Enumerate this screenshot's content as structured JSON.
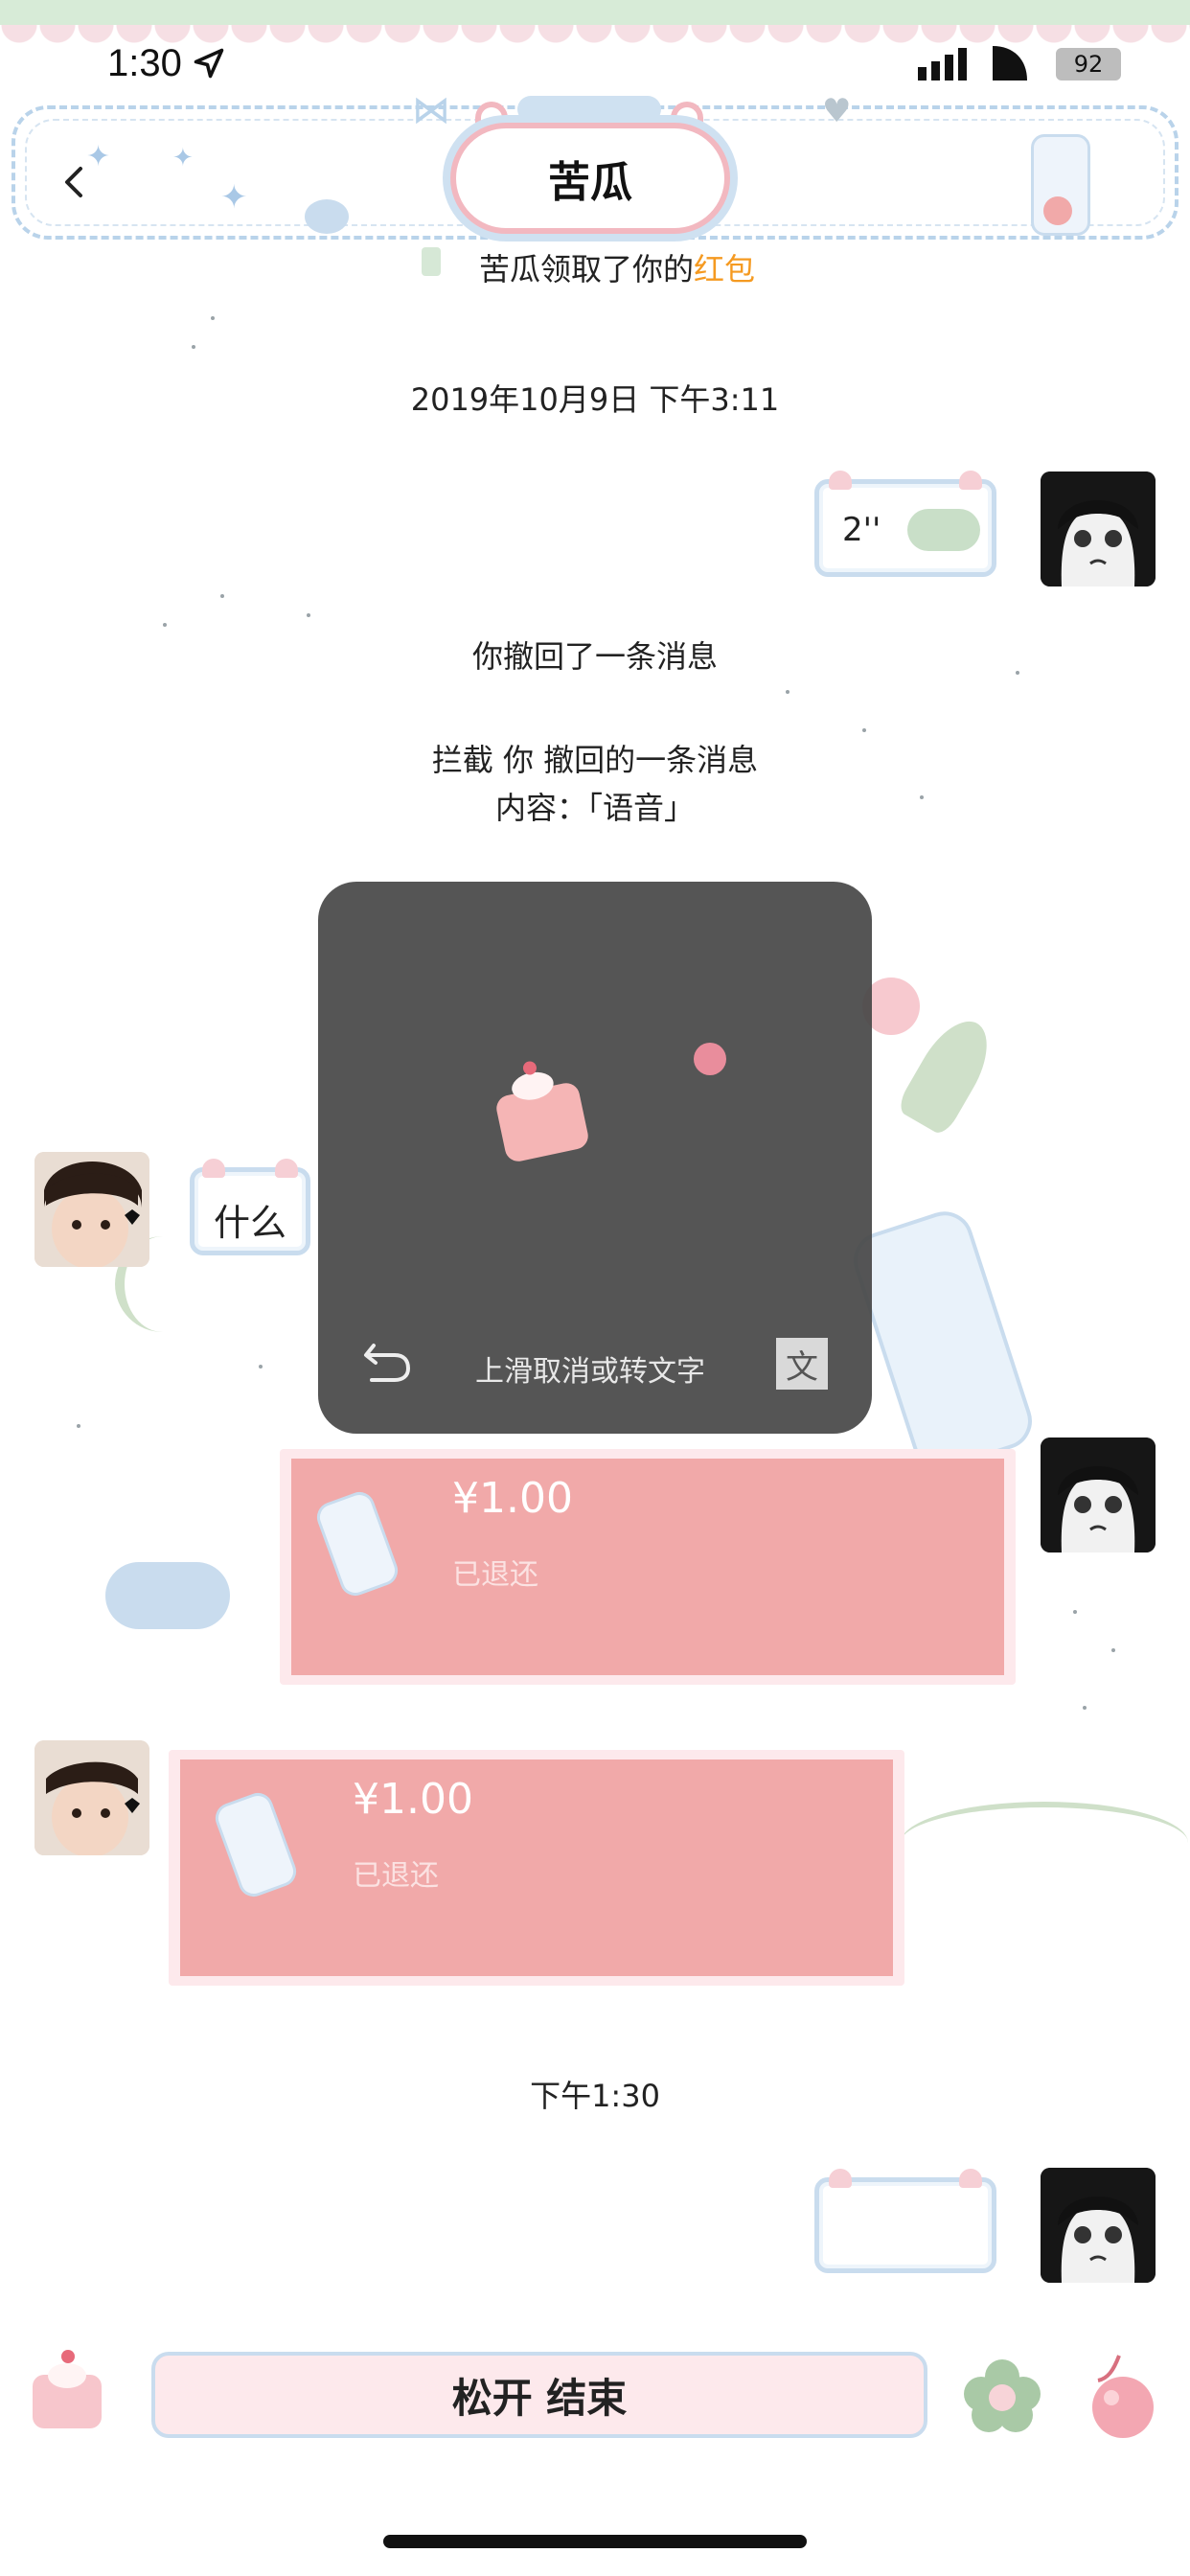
{
  "status_bar": {
    "time": "1:30",
    "battery": "92"
  },
  "header": {
    "title": "苦瓜"
  },
  "messages": {
    "redpacket_notice_prefix": "苦瓜领取了你的",
    "redpacket_notice_accent": "红包",
    "timestamp_1": "2019年10月9日 下午3:11",
    "voice_duration": "2''",
    "recalled_notice": "你撤回了一条消息",
    "intercept_line1": "拦截 你 撤回的一条消息",
    "intercept_line2": "内容：「语音」",
    "incoming_text": "什么",
    "redpack_out": {
      "amount": "¥1.00",
      "status": "已退还"
    },
    "redpack_in": {
      "amount": "¥1.00",
      "status": "已退还"
    },
    "timestamp_2": "下午1:30"
  },
  "voice_overlay": {
    "hint": "上滑取消或转文字",
    "text_button": "文"
  },
  "input_bar": {
    "hold_label": "松开 结束"
  },
  "colors": {
    "accent_orange": "#f59a21",
    "redpack": "#f1a9a9",
    "bubble_border": "#c9dcee",
    "overlay": "#464646"
  }
}
